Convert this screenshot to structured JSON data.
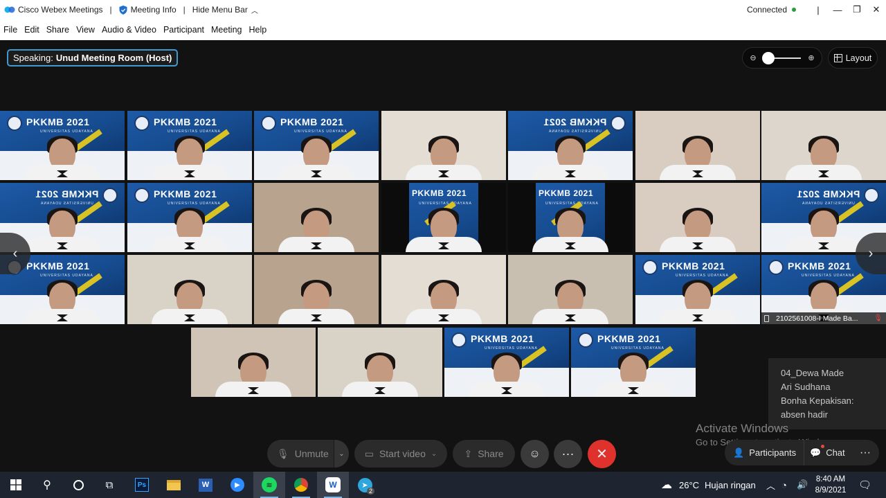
{
  "titlebar": {
    "app_title": "Cisco Webex Meetings",
    "meeting_info": "Meeting Info",
    "hide_menu": "Hide Menu Bar",
    "status": "Connected",
    "status_color": "#2a9d3a"
  },
  "menu": [
    "File",
    "Edit",
    "Share",
    "View",
    "Audio & Video",
    "Participant",
    "Meeting",
    "Help"
  ],
  "speaking": {
    "prefix": "Speaking:",
    "name": "Unud Meeting Room (Host)"
  },
  "layout_label": "Layout",
  "zoom_icons": {
    "out": "zoom-out-icon",
    "in": "zoom-in-icon"
  },
  "banner_text": "PKKMB 2021",
  "banner_subtext": "UNIVERSITAS UDAYANA",
  "highlight_tile_name": "2102561008-I Made Ba...",
  "chat_popup": [
    "04_Dewa Made",
    "Ari Sudhana",
    "Bonha Kepakisan:",
    "absen hadir"
  ],
  "watermark": {
    "line1": "Activate Windows",
    "line2": "Go to Settings to activate Windows."
  },
  "controls": {
    "unmute": "Unmute",
    "start_video": "Start video",
    "share": "Share",
    "participants": "Participants",
    "chat": "Chat"
  },
  "taskbar": {
    "weather_temp": "26°C",
    "weather_text": "Hujan ringan",
    "time": "8:40 AM",
    "date": "8/9/2021",
    "telegram_badge": "2"
  },
  "colors": {
    "accent": "#3f9ad2",
    "leave": "#e0322d"
  }
}
